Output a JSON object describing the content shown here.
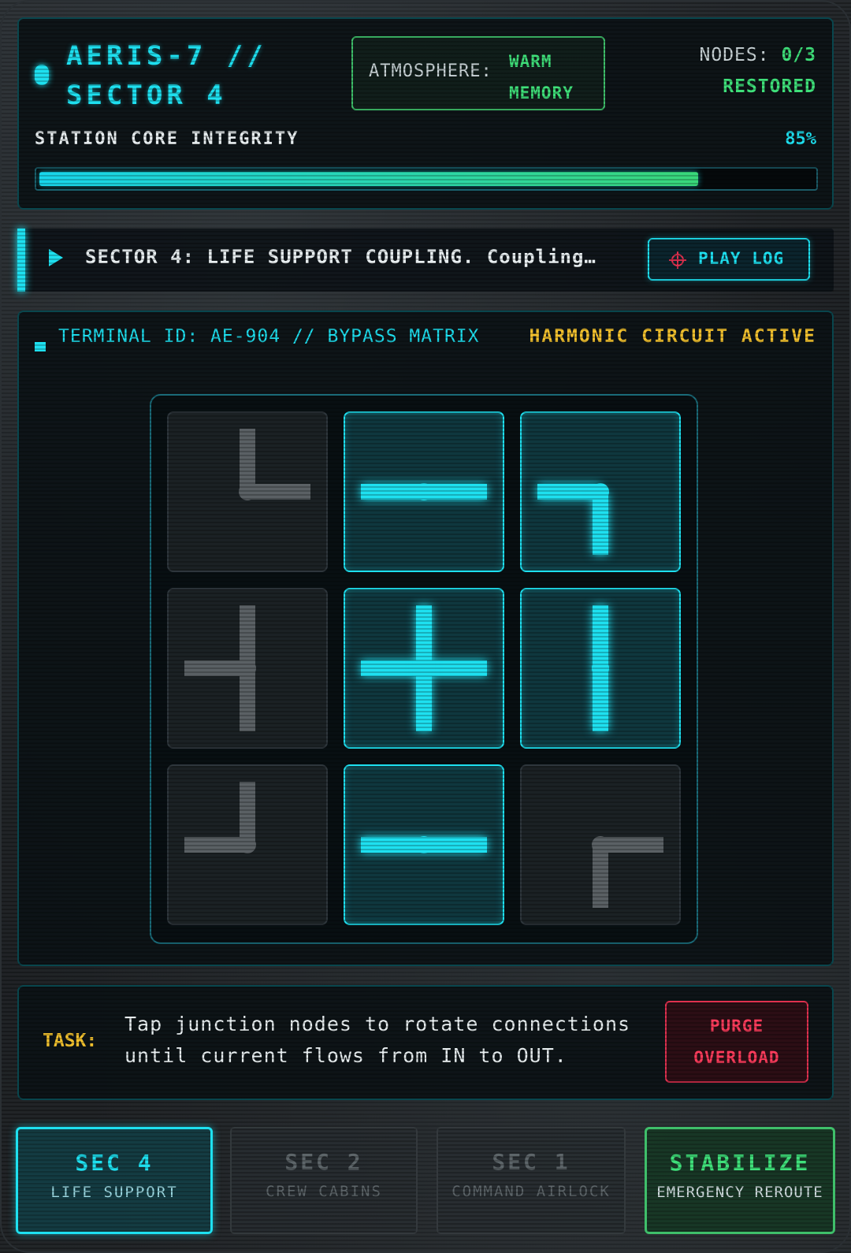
{
  "header": {
    "title_line1": "AERIS-7 //",
    "title_line2": "SECTOR 4",
    "atmosphere_label": "ATMOSPHERE:",
    "atmosphere_value_line1": "WARM",
    "atmosphere_value_line2": "MEMORY",
    "nodes_label": "NODES:",
    "nodes_value": "0/3",
    "nodes_sub": "RESTORED",
    "integrity_label": "STATION CORE INTEGRITY",
    "integrity_value": "85%",
    "integrity_fraction": 0.85
  },
  "log": {
    "text": "SECTOR 4: LIFE SUPPORT COUPLING. Coupling…",
    "play_label": "PLAY LOG"
  },
  "terminal": {
    "id": "TERMINAL ID: AE-904 // BYPASS MATRIX",
    "status": "HARMONIC CIRCUIT ACTIVE",
    "grid": [
      {
        "id": "r0c0",
        "pipe": "corner-up-right",
        "energized": false
      },
      {
        "id": "r0c1",
        "pipe": "straight-horizontal",
        "energized": true
      },
      {
        "id": "r0c2",
        "pipe": "corner-left-down",
        "energized": true
      },
      {
        "id": "r1c0",
        "pipe": "tee-up-left-down",
        "energized": false
      },
      {
        "id": "r1c1",
        "pipe": "cross",
        "energized": true
      },
      {
        "id": "r1c2",
        "pipe": "straight-vertical",
        "energized": true
      },
      {
        "id": "r2c0",
        "pipe": "corner-up-left",
        "energized": false
      },
      {
        "id": "r2c1",
        "pipe": "straight-horizontal",
        "energized": true
      },
      {
        "id": "r2c2",
        "pipe": "corner-right-down",
        "energized": false
      }
    ]
  },
  "task": {
    "label": "TASK:",
    "text": "Tap junction nodes to rotate connections until current flows from IN to OUT.",
    "purge_line1": "PURGE",
    "purge_line2": "OVERLOAD"
  },
  "tabs": [
    {
      "title": "SEC 4",
      "subtitle": "LIFE SUPPORT",
      "state": "active"
    },
    {
      "title": "SEC 2",
      "subtitle": "CREW CABINS",
      "state": "locked"
    },
    {
      "title": "SEC 1",
      "subtitle": "COMMAND AIRLOCK",
      "state": "locked"
    },
    {
      "title": "STABILIZE",
      "subtitle": "EMERGENCY REROUTE",
      "state": "action"
    }
  ],
  "colors": {
    "accent": "#1ee0f0",
    "ok": "#3fe07a",
    "warn": "#f2c12e",
    "danger": "#ff3c5c",
    "pipe_off": "#5a6064"
  },
  "icons": {
    "play_log": "crosshair-icon",
    "log_marker": "play-triangle-icon"
  }
}
